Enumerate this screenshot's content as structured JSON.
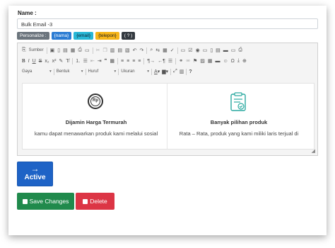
{
  "form": {
    "name_label": "Name :",
    "name_value": "Bulk Email -3"
  },
  "personalize": {
    "label": "Personalize :",
    "tags": [
      "{nama}",
      "{email}",
      "{telepon}",
      "( ? )"
    ]
  },
  "editor": {
    "toolbar": {
      "source_label": "Sumber",
      "format_dropdowns": [
        "Gaya",
        "Bentuk",
        "Huruf",
        "Ukuran"
      ],
      "help_label": "?"
    },
    "content": {
      "left": {
        "icon": "rupiah-coin-icon",
        "icon_text": "Rp",
        "title": "Dijamin Harga Termurah",
        "desc": "kamu dapat menawarkan produk kami melalui sosial"
      },
      "right": {
        "icon": "clipboard-check-icon",
        "title": "Banyak pilihan produk",
        "desc": "Rata – Rata, produk yang kami miliki laris terjual di"
      }
    }
  },
  "actions": {
    "active_arrow": "→",
    "active_label": "Active",
    "save_label": "Save Changes",
    "delete_label": "Delete"
  },
  "colors": {
    "active": "#1e63c6",
    "save": "#208a4c",
    "delete": "#dc3545"
  }
}
